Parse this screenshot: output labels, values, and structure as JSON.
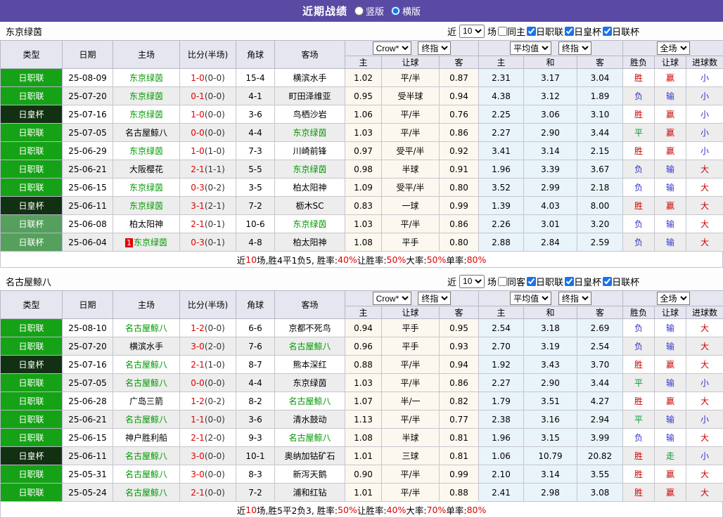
{
  "colors": {
    "header_purple": "#5a4aa4",
    "league_j1_green": "#16a216",
    "league_emperor_darkgreen": "#123012",
    "league_cup_sage": "#55a05c",
    "team_highlight_green": "#009900",
    "score_red": "#e00000",
    "win_red": "#cc0000",
    "lose_blue": "#3333cc",
    "draw_green": "#009933",
    "crow_column_bg": "#fdf8ef",
    "average_column_bg": "#e9f3fa"
  },
  "title_bar": {
    "title": "近期战绩",
    "radio_vertical": "竖版",
    "radio_horizontal": "横版"
  },
  "table_header": {
    "type": "类型",
    "date": "日期",
    "home": "主场",
    "score": "比分(半场)",
    "corner": "角球",
    "away": "客场",
    "crow_home": "主",
    "crow_handicap": "让球",
    "crow_away": "客",
    "avg_home": "主",
    "avg_draw": "和",
    "avg_away": "客",
    "result": "胜负",
    "handicap": "让球",
    "goals": "进球数"
  },
  "sections": [
    {
      "team": "东京绿茵",
      "filter": {
        "prefix": "近",
        "count": "10",
        "suffix": "场",
        "same": "同主",
        "leagues": [
          "日职联",
          "日皇杯",
          "日联杯"
        ]
      },
      "selects": {
        "source": "Crow*",
        "source_final": "终指",
        "avg": "平均值",
        "avg_final": "终指",
        "scope": "全场"
      },
      "rows": [
        {
          "league": "日职联",
          "lg": "j1",
          "date": "25-08-09",
          "home": "东京绿茵",
          "home_hl": true,
          "badge": "",
          "score": "1-0",
          "half": "(0-0)",
          "corner": "15-4",
          "away": "横滨水手",
          "away_hl": false,
          "crow": [
            "1.02",
            "平/半",
            "0.87"
          ],
          "avg": [
            "2.31",
            "3.17",
            "3.04"
          ],
          "res": [
            "胜",
            "r"
          ],
          "hres": [
            "赢",
            "r"
          ],
          "gres": [
            "小",
            "b"
          ]
        },
        {
          "league": "日职联",
          "lg": "j1",
          "date": "25-07-20",
          "home": "东京绿茵",
          "home_hl": true,
          "badge": "",
          "score": "0-1",
          "half": "(0-0)",
          "corner": "4-1",
          "away": "町田泽维亚",
          "away_hl": false,
          "crow": [
            "0.95",
            "受半球",
            "0.94"
          ],
          "avg": [
            "4.38",
            "3.12",
            "1.89"
          ],
          "res": [
            "负",
            "b"
          ],
          "hres": [
            "输",
            "b"
          ],
          "gres": [
            "小",
            "b"
          ]
        },
        {
          "league": "日皇杯",
          "lg": "emp",
          "date": "25-07-16",
          "home": "东京绿茵",
          "home_hl": true,
          "badge": "",
          "score": "1-0",
          "half": "(0-0)",
          "corner": "3-6",
          "away": "鸟栖沙岩",
          "away_hl": false,
          "crow": [
            "1.06",
            "平/半",
            "0.76"
          ],
          "avg": [
            "2.25",
            "3.06",
            "3.10"
          ],
          "res": [
            "胜",
            "r"
          ],
          "hres": [
            "赢",
            "r"
          ],
          "gres": [
            "小",
            "b"
          ]
        },
        {
          "league": "日职联",
          "lg": "j1",
          "date": "25-07-05",
          "home": "名古屋鲸八",
          "home_hl": false,
          "badge": "",
          "score": "0-0",
          "half": "(0-0)",
          "corner": "4-4",
          "away": "东京绿茵",
          "away_hl": true,
          "crow": [
            "1.03",
            "平/半",
            "0.86"
          ],
          "avg": [
            "2.27",
            "2.90",
            "3.44"
          ],
          "res": [
            "平",
            "g"
          ],
          "hres": [
            "赢",
            "r"
          ],
          "gres": [
            "小",
            "b"
          ]
        },
        {
          "league": "日职联",
          "lg": "j1",
          "date": "25-06-29",
          "home": "东京绿茵",
          "home_hl": true,
          "badge": "",
          "score": "1-0",
          "half": "(1-0)",
          "corner": "7-3",
          "away": "川崎前锋",
          "away_hl": false,
          "crow": [
            "0.97",
            "受平/半",
            "0.92"
          ],
          "avg": [
            "3.41",
            "3.14",
            "2.15"
          ],
          "res": [
            "胜",
            "r"
          ],
          "hres": [
            "赢",
            "r"
          ],
          "gres": [
            "小",
            "b"
          ]
        },
        {
          "league": "日职联",
          "lg": "j1",
          "date": "25-06-21",
          "home": "大阪樱花",
          "home_hl": false,
          "badge": "",
          "score": "2-1",
          "half": "(1-1)",
          "corner": "5-5",
          "away": "东京绿茵",
          "away_hl": true,
          "crow": [
            "0.98",
            "半球",
            "0.91"
          ],
          "avg": [
            "1.96",
            "3.39",
            "3.67"
          ],
          "res": [
            "负",
            "b"
          ],
          "hres": [
            "输",
            "b"
          ],
          "gres": [
            "大",
            "r"
          ]
        },
        {
          "league": "日职联",
          "lg": "j1",
          "date": "25-06-15",
          "home": "东京绿茵",
          "home_hl": true,
          "badge": "",
          "score": "0-3",
          "half": "(0-2)",
          "corner": "3-5",
          "away": "柏太阳神",
          "away_hl": false,
          "crow": [
            "1.09",
            "受平/半",
            "0.80"
          ],
          "avg": [
            "3.52",
            "2.99",
            "2.18"
          ],
          "res": [
            "负",
            "b"
          ],
          "hres": [
            "输",
            "b"
          ],
          "gres": [
            "大",
            "r"
          ]
        },
        {
          "league": "日皇杯",
          "lg": "emp",
          "date": "25-06-11",
          "home": "东京绿茵",
          "home_hl": true,
          "badge": "",
          "score": "3-1",
          "half": "(2-1)",
          "corner": "7-2",
          "away": "枥木SC",
          "away_hl": false,
          "crow": [
            "0.83",
            "一球",
            "0.99"
          ],
          "avg": [
            "1.39",
            "4.03",
            "8.00"
          ],
          "res": [
            "胜",
            "r"
          ],
          "hres": [
            "赢",
            "r"
          ],
          "gres": [
            "大",
            "r"
          ]
        },
        {
          "league": "日联杯",
          "lg": "cup",
          "date": "25-06-08",
          "home": "柏太阳神",
          "home_hl": false,
          "badge": "",
          "score": "2-1",
          "half": "(0-1)",
          "corner": "10-6",
          "away": "东京绿茵",
          "away_hl": true,
          "crow": [
            "1.03",
            "平/半",
            "0.86"
          ],
          "avg": [
            "2.26",
            "3.01",
            "3.20"
          ],
          "res": [
            "负",
            "b"
          ],
          "hres": [
            "输",
            "b"
          ],
          "gres": [
            "大",
            "r"
          ]
        },
        {
          "league": "日联杯",
          "lg": "cup",
          "date": "25-06-04",
          "home": "东京绿茵",
          "home_hl": true,
          "badge": "1",
          "score": "0-3",
          "half": "(0-1)",
          "corner": "4-8",
          "away": "柏太阳神",
          "away_hl": false,
          "crow": [
            "1.08",
            "平手",
            "0.80"
          ],
          "avg": [
            "2.88",
            "2.84",
            "2.59"
          ],
          "res": [
            "负",
            "b"
          ],
          "hres": [
            "输",
            "b"
          ],
          "gres": [
            "大",
            "r"
          ]
        }
      ],
      "summary": [
        {
          "t": "近",
          "r": false
        },
        {
          "t": "10",
          "r": true
        },
        {
          "t": "场,胜4平1负5, 胜率:",
          "r": false
        },
        {
          "t": "40%",
          "r": true
        },
        {
          "t": " 让胜率:",
          "r": false
        },
        {
          "t": "50%",
          "r": true
        },
        {
          "t": " 大率:",
          "r": false
        },
        {
          "t": "50%",
          "r": true
        },
        {
          "t": " 单率:",
          "r": false
        },
        {
          "t": "80%",
          "r": true
        }
      ]
    },
    {
      "team": "名古屋鲸八",
      "filter": {
        "prefix": "近",
        "count": "10",
        "suffix": "场",
        "same": "同客",
        "leagues": [
          "日职联",
          "日皇杯",
          "日联杯"
        ]
      },
      "selects": {
        "source": "Crow*",
        "source_final": "终指",
        "avg": "平均值",
        "avg_final": "终指",
        "scope": "全场"
      },
      "rows": [
        {
          "league": "日职联",
          "lg": "j1",
          "date": "25-08-10",
          "home": "名古屋鲸八",
          "home_hl": true,
          "badge": "",
          "score": "1-2",
          "half": "(0-0)",
          "corner": "6-6",
          "away": "京都不死鸟",
          "away_hl": false,
          "crow": [
            "0.94",
            "平手",
            "0.95"
          ],
          "avg": [
            "2.54",
            "3.18",
            "2.69"
          ],
          "res": [
            "负",
            "b"
          ],
          "hres": [
            "输",
            "b"
          ],
          "gres": [
            "大",
            "r"
          ]
        },
        {
          "league": "日职联",
          "lg": "j1",
          "date": "25-07-20",
          "home": "横滨水手",
          "home_hl": false,
          "badge": "",
          "score": "3-0",
          "half": "(2-0)",
          "corner": "7-6",
          "away": "名古屋鲸八",
          "away_hl": true,
          "crow": [
            "0.96",
            "平手",
            "0.93"
          ],
          "avg": [
            "2.70",
            "3.19",
            "2.54"
          ],
          "res": [
            "负",
            "b"
          ],
          "hres": [
            "输",
            "b"
          ],
          "gres": [
            "大",
            "r"
          ]
        },
        {
          "league": "日皇杯",
          "lg": "emp",
          "date": "25-07-16",
          "home": "名古屋鲸八",
          "home_hl": true,
          "badge": "",
          "score": "2-1",
          "half": "(1-0)",
          "corner": "8-7",
          "away": "熊本深红",
          "away_hl": false,
          "crow": [
            "0.88",
            "平/半",
            "0.94"
          ],
          "avg": [
            "1.92",
            "3.43",
            "3.70"
          ],
          "res": [
            "胜",
            "r"
          ],
          "hres": [
            "赢",
            "r"
          ],
          "gres": [
            "大",
            "r"
          ]
        },
        {
          "league": "日职联",
          "lg": "j1",
          "date": "25-07-05",
          "home": "名古屋鲸八",
          "home_hl": true,
          "badge": "",
          "score": "0-0",
          "half": "(0-0)",
          "corner": "4-4",
          "away": "东京绿茵",
          "away_hl": false,
          "crow": [
            "1.03",
            "平/半",
            "0.86"
          ],
          "avg": [
            "2.27",
            "2.90",
            "3.44"
          ],
          "res": [
            "平",
            "g"
          ],
          "hres": [
            "输",
            "b"
          ],
          "gres": [
            "小",
            "b"
          ]
        },
        {
          "league": "日职联",
          "lg": "j1",
          "date": "25-06-28",
          "home": "广岛三箭",
          "home_hl": false,
          "badge": "",
          "score": "1-2",
          "half": "(0-2)",
          "corner": "8-2",
          "away": "名古屋鲸八",
          "away_hl": true,
          "crow": [
            "1.07",
            "半/一",
            "0.82"
          ],
          "avg": [
            "1.79",
            "3.51",
            "4.27"
          ],
          "res": [
            "胜",
            "r"
          ],
          "hres": [
            "赢",
            "r"
          ],
          "gres": [
            "大",
            "r"
          ]
        },
        {
          "league": "日职联",
          "lg": "j1",
          "date": "25-06-21",
          "home": "名古屋鲸八",
          "home_hl": true,
          "badge": "",
          "score": "1-1",
          "half": "(0-0)",
          "corner": "3-6",
          "away": "清水鼓动",
          "away_hl": false,
          "crow": [
            "1.13",
            "平/半",
            "0.77"
          ],
          "avg": [
            "2.38",
            "3.16",
            "2.94"
          ],
          "res": [
            "平",
            "g"
          ],
          "hres": [
            "输",
            "b"
          ],
          "gres": [
            "小",
            "b"
          ]
        },
        {
          "league": "日职联",
          "lg": "j1",
          "date": "25-06-15",
          "home": "神户胜利船",
          "home_hl": false,
          "badge": "",
          "score": "2-1",
          "half": "(2-0)",
          "corner": "9-3",
          "away": "名古屋鲸八",
          "away_hl": true,
          "crow": [
            "1.08",
            "半球",
            "0.81"
          ],
          "avg": [
            "1.96",
            "3.15",
            "3.99"
          ],
          "res": [
            "负",
            "b"
          ],
          "hres": [
            "输",
            "b"
          ],
          "gres": [
            "大",
            "r"
          ]
        },
        {
          "league": "日皇杯",
          "lg": "emp",
          "date": "25-06-11",
          "home": "名古屋鲸八",
          "home_hl": true,
          "badge": "",
          "score": "3-0",
          "half": "(0-0)",
          "corner": "10-1",
          "away": "奥纳加钴矿石",
          "away_hl": false,
          "crow": [
            "1.01",
            "三球",
            "0.81"
          ],
          "avg": [
            "1.06",
            "10.79",
            "20.82"
          ],
          "res": [
            "胜",
            "r"
          ],
          "hres": [
            "走",
            "g"
          ],
          "gres": [
            "小",
            "b"
          ]
        },
        {
          "league": "日职联",
          "lg": "j1",
          "date": "25-05-31",
          "home": "名古屋鲸八",
          "home_hl": true,
          "badge": "",
          "score": "3-0",
          "half": "(0-0)",
          "corner": "8-3",
          "away": "新泻天鹅",
          "away_hl": false,
          "crow": [
            "0.90",
            "平/半",
            "0.99"
          ],
          "avg": [
            "2.10",
            "3.14",
            "3.55"
          ],
          "res": [
            "胜",
            "r"
          ],
          "hres": [
            "赢",
            "r"
          ],
          "gres": [
            "大",
            "r"
          ]
        },
        {
          "league": "日职联",
          "lg": "j1",
          "date": "25-05-24",
          "home": "名古屋鲸八",
          "home_hl": true,
          "badge": "",
          "score": "2-1",
          "half": "(0-0)",
          "corner": "7-2",
          "away": "浦和红钻",
          "away_hl": false,
          "crow": [
            "1.01",
            "平/半",
            "0.88"
          ],
          "avg": [
            "2.41",
            "2.98",
            "3.08"
          ],
          "res": [
            "胜",
            "r"
          ],
          "hres": [
            "赢",
            "r"
          ],
          "gres": [
            "大",
            "r"
          ]
        }
      ],
      "summary": [
        {
          "t": "近",
          "r": false
        },
        {
          "t": "10",
          "r": true
        },
        {
          "t": "场,胜5平2负3, 胜率:",
          "r": false
        },
        {
          "t": "50%",
          "r": true
        },
        {
          "t": " 让胜率:",
          "r": false
        },
        {
          "t": "40%",
          "r": true
        },
        {
          "t": " 大率:",
          "r": false
        },
        {
          "t": "70%",
          "r": true
        },
        {
          "t": " 单率:",
          "r": false
        },
        {
          "t": "80%",
          "r": true
        }
      ]
    }
  ]
}
